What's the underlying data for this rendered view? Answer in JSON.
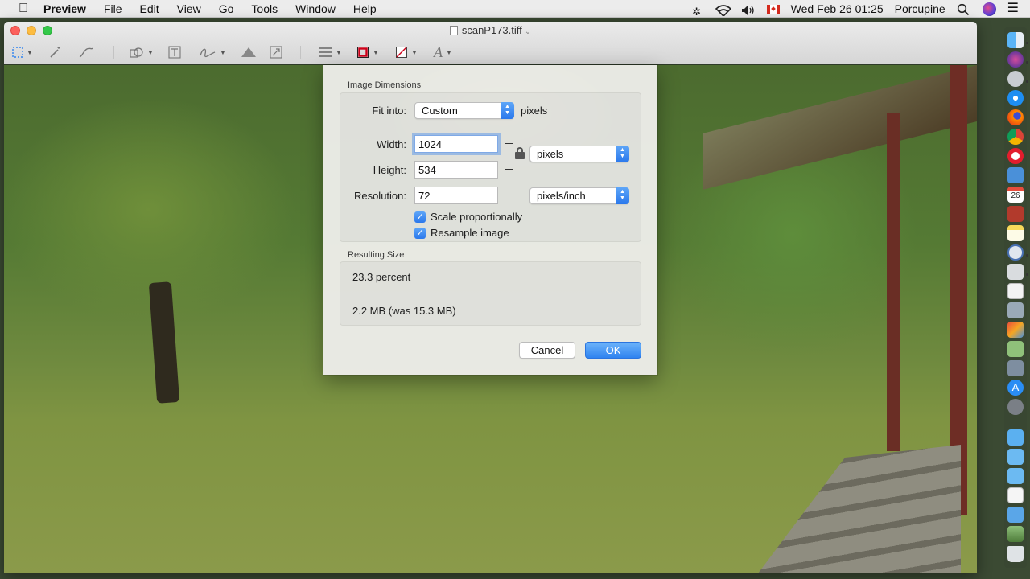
{
  "menubar": {
    "app_name": "Preview",
    "items": [
      "File",
      "Edit",
      "View",
      "Go",
      "Tools",
      "Window",
      "Help"
    ],
    "clock": "Wed Feb 26  01:25",
    "user": "Porcupine"
  },
  "window": {
    "title": "scanP173.tiff"
  },
  "dialog": {
    "image_dimensions_label": "Image Dimensions",
    "fit_into_label": "Fit into:",
    "fit_into_value": "Custom",
    "fit_into_unit": "pixels",
    "width_label": "Width:",
    "width_value": "1024",
    "height_label": "Height:",
    "height_value": "534",
    "resolution_label": "Resolution:",
    "resolution_value": "72",
    "size_unit": "pixels",
    "resolution_unit": "pixels/inch",
    "scale_label": "Scale proportionally",
    "scale_checked": true,
    "resample_label": "Resample image",
    "resample_checked": true,
    "resulting_size_label": "Resulting Size",
    "percent_text": "23.3 percent",
    "filesize_text": "2.2 MB (was 15.3 MB)",
    "cancel_label": "Cancel",
    "ok_label": "OK"
  },
  "dock": {
    "icons": [
      "finder-icon",
      "siri-icon",
      "launchpad-icon",
      "safari-icon",
      "firefox-icon",
      "chrome-icon",
      "opera-icon",
      "mail-icon",
      "calendar-icon",
      "dictionary-icon",
      "notes-icon",
      "bbedit-icon",
      "preview-icon",
      "textedit-icon",
      "image-capture-icon",
      "photo-booth-icon",
      "preview-photos-icon",
      "screenshot-icon",
      "app-store-icon",
      "system-preferences-icon",
      "folder-icon",
      "folder-icon-2",
      "folder-icon-3",
      "document-icon",
      "downloads-icon",
      "image-icon",
      "trash-icon"
    ],
    "colors": {
      "accent": "#2f83f0",
      "close": "#fc605c",
      "minimize": "#fdbc40",
      "maximize": "#34c84a"
    }
  }
}
